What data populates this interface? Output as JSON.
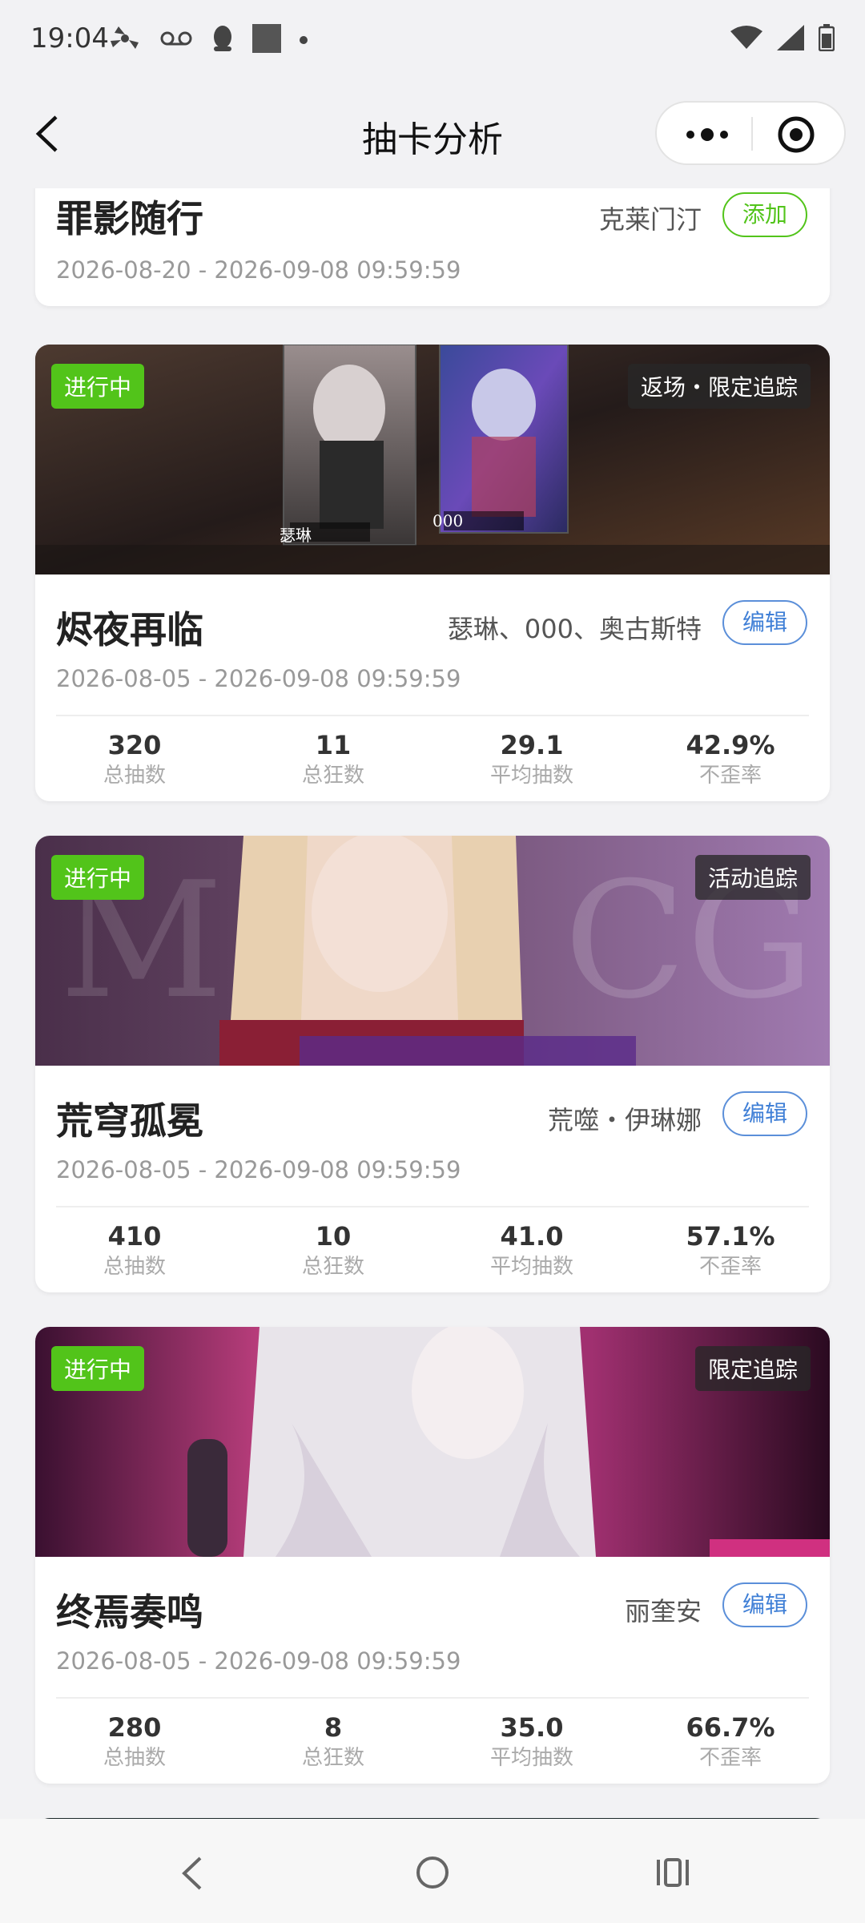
{
  "status_bar": {
    "time": "19:04"
  },
  "nav": {
    "title": "抽卡分析"
  },
  "cards": [
    {
      "name": "罪影随行",
      "characters": "克莱门汀",
      "button": "添加",
      "date": "2026-08-20 - 2026-09-08 09:59:59"
    },
    {
      "status": "进行中",
      "tag": "返场・限定追踪",
      "banner_labels": [
        "瑟琳",
        "000"
      ],
      "name": "烬夜再临",
      "characters": "瑟琳、000、奥古斯特",
      "button": "编辑",
      "date": "2026-08-05 - 2026-09-08 09:59:59",
      "stats": [
        {
          "value": "320",
          "label": "总抽数"
        },
        {
          "value": "11",
          "label": "总狂数"
        },
        {
          "value": "29.1",
          "label": "平均抽数"
        },
        {
          "value": "42.9%",
          "label": "不歪率"
        }
      ]
    },
    {
      "status": "进行中",
      "tag": "活动追踪",
      "name": "荒穹孤冕",
      "characters": "荒噬・伊琳娜",
      "button": "编辑",
      "date": "2026-08-05 - 2026-09-08 09:59:59",
      "stats": [
        {
          "value": "410",
          "label": "总抽数"
        },
        {
          "value": "10",
          "label": "总狂数"
        },
        {
          "value": "41.0",
          "label": "平均抽数"
        },
        {
          "value": "57.1%",
          "label": "不歪率"
        }
      ]
    },
    {
      "status": "进行中",
      "tag": "限定追踪",
      "name": "终焉奏鸣",
      "characters": "丽奎安",
      "button": "编辑",
      "date": "2026-08-05 - 2026-09-08 09:59:59",
      "stats": [
        {
          "value": "280",
          "label": "总抽数"
        },
        {
          "value": "8",
          "label": "总狂数"
        },
        {
          "value": "35.0",
          "label": "平均抽数"
        },
        {
          "value": "66.7%",
          "label": "不歪率"
        }
      ]
    }
  ],
  "colors": {
    "status_green": "#52c41a",
    "edit_blue": "#3f7fd6",
    "add_green": "#52c41a"
  }
}
